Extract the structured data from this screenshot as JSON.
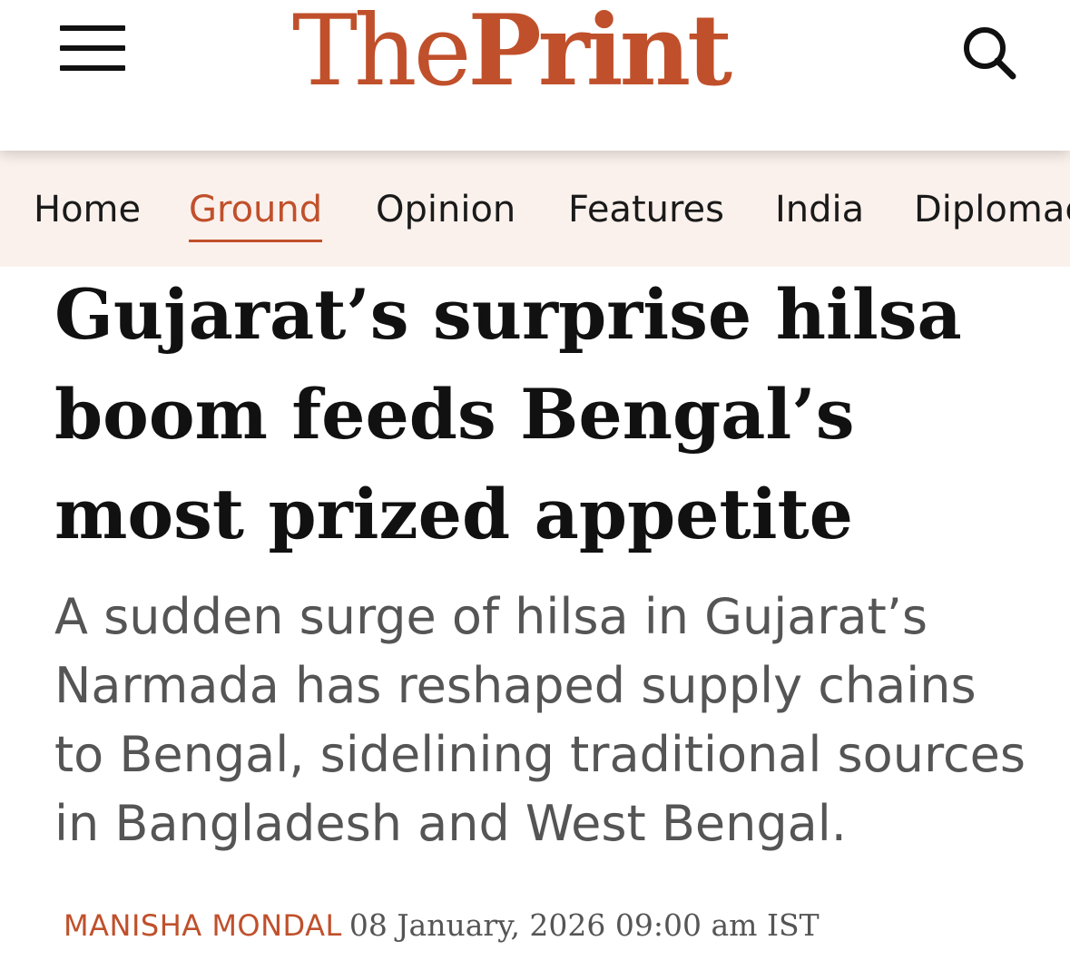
{
  "header": {
    "logo_the": "The",
    "logo_print": "Print",
    "menu_icon": "hamburger-menu-icon",
    "search_icon": "search-icon",
    "brand_color": "#c0502b"
  },
  "nav": {
    "items": [
      {
        "label": "Home",
        "active": false
      },
      {
        "label": "Ground",
        "active": true
      },
      {
        "label": "Opinion",
        "active": false
      },
      {
        "label": "Features",
        "active": false
      },
      {
        "label": "India",
        "active": false
      },
      {
        "label": "Diplomacy",
        "active": false
      }
    ],
    "background": "#fbf1ec"
  },
  "article": {
    "headline": "Gujarat’s surprise hilsa boom feeds Bengal’s most prized appetite",
    "summary": "A sudden surge of hilsa in Gujarat’s Narmada has reshaped supply chains to Bengal, sidelining traditional sources in Bangladesh and West Bengal.",
    "author": "MANISHA MONDAL",
    "date": "08 January, 2026 09:00 am IST"
  }
}
